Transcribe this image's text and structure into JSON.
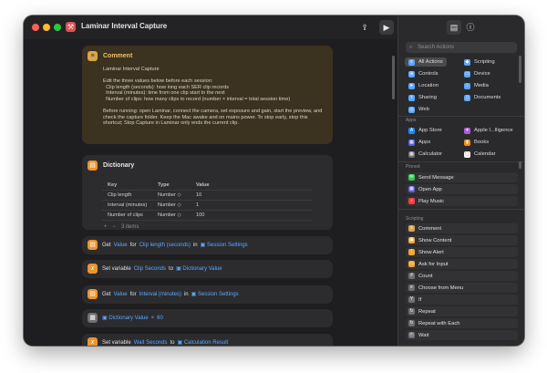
{
  "window": {
    "title": "Laminar Interval Capture"
  },
  "colors": {
    "accent": "#5aa7ff",
    "comment_bg": "#3b3220",
    "orange": "#e8962c",
    "red": "#e2504f",
    "yellow": "#f0a63a"
  },
  "comment": {
    "title": "Comment",
    "text": "Laminar Interval Capture\n\nEdit the three values below before each session:\n  Clip length (seconds): how long each SER clip records\n  Interval (minutes): time from one clip start to the next\n  Number of clips: how many clips to record (number × interval = total session time)\n\nBefore running: open Laminar, connect the camera, set exposure and gain, start the preview, and check the capture folder. Keep the Mac awake and on mains power. To stop early, stop this shortcut; Stop Capture in Laminar only ends the current clip."
  },
  "dictionary": {
    "title": "Dictionary",
    "headers": [
      "Key",
      "Type",
      "Value"
    ],
    "rows": [
      [
        "Clip length",
        "Number ◇",
        "10"
      ],
      [
        "Interval (minutes)",
        "Number ◇",
        "1"
      ],
      [
        "Number of clips",
        "Number ◇",
        "100"
      ]
    ],
    "footer": "3 items",
    "add": "+",
    "remove": "−"
  },
  "actions": [
    {
      "verb": "Get",
      "a": "Value",
      "b": "for",
      "c": "Clip length (seconds)",
      "d": "in",
      "e": "Session Settings"
    },
    {
      "verb": "Set variable",
      "a": "Clip Seconds",
      "b": "to",
      "e": "Dictionary Value"
    },
    {
      "verb": "Get",
      "a": "Value",
      "b": "for",
      "c": "Interval (minutes)",
      "d": "in",
      "e": "Session Settings"
    },
    {
      "verb": "",
      "a": "Dictionary Value",
      "b": "×",
      "c": "60"
    },
    {
      "verb": "Set variable",
      "a": "Wait Seconds",
      "b": "to",
      "e": "Calculation Result"
    }
  ],
  "sidebar": {
    "search_placeholder": "Search Actions",
    "categories": [
      [
        "All Actions",
        "Scripting"
      ],
      [
        "Controls",
        "Device"
      ],
      [
        "Location",
        "Media"
      ],
      [
        "Sharing",
        "Documents"
      ],
      [
        "Web",
        ""
      ]
    ],
    "apps_label": "Apps",
    "apps": [
      [
        "App Store",
        "Apple I...lligence"
      ],
      [
        "Apps",
        "Books"
      ],
      [
        "Calculator",
        "Calendar"
      ]
    ],
    "pinned_label": "Pinned",
    "pinned": [
      "Send Message",
      "Open App",
      "Play Music"
    ],
    "scripting_label": "Scripting",
    "scripting": [
      "Comment",
      "Show Content",
      "Show Alert",
      "Ask for Input",
      "Count",
      "Choose from Menu",
      "If",
      "Repeat",
      "Repeat with Each",
      "Wait"
    ]
  }
}
